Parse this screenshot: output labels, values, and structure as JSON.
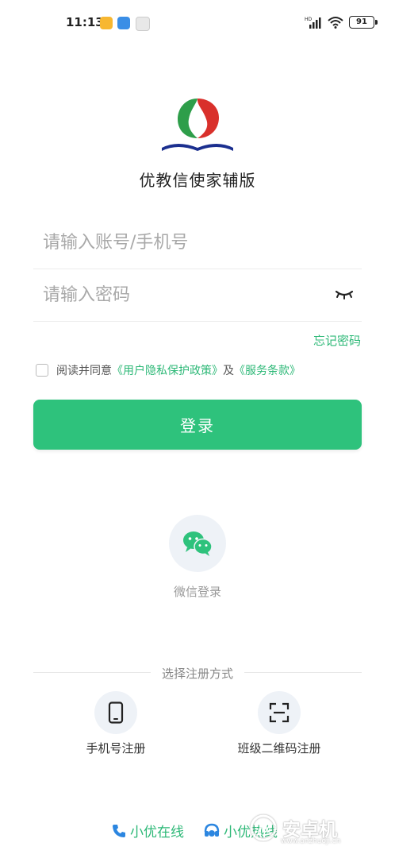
{
  "status_bar": {
    "time": "11:13",
    "battery": "91",
    "network_label": "HD"
  },
  "app": {
    "name": "优教信使家辅版"
  },
  "login": {
    "account_placeholder": "请输入账号/手机号",
    "password_placeholder": "请输入密码",
    "forgot_password": "忘记密码",
    "agree_prefix": "阅读并同意",
    "privacy_link": "《用户隐私保护政策》",
    "agree_and": "及",
    "terms_link": "《服务条款》",
    "login_button": "登录"
  },
  "wechat_login": {
    "label": "微信登录"
  },
  "register": {
    "title": "选择注册方式",
    "options": [
      {
        "label": "手机号注册",
        "icon": "phone-icon"
      },
      {
        "label": "班级二维码注册",
        "icon": "qr-scan-icon"
      }
    ]
  },
  "footer": {
    "online_label": "小优在线",
    "hotline_label": "小优热线"
  },
  "watermark": {
    "text": "安卓机",
    "url": "www.anzhuoji.cn"
  },
  "colors": {
    "accent": "#2ec27c",
    "link": "#2db877"
  }
}
